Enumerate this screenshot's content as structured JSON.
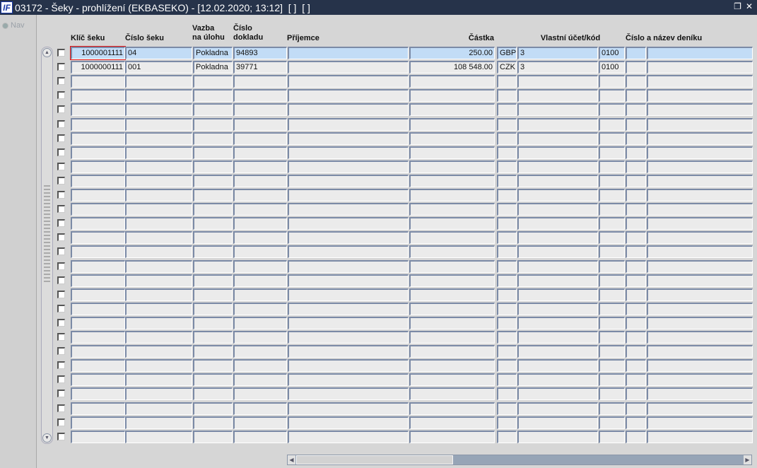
{
  "window": {
    "title": "03172 - Šeky - prohlížení (EKBASEKO) - [12.02.2020; 13:12]  [ ]  [ ]",
    "logo": "IF",
    "restore_icon": "restore-icon",
    "close_icon": "close-icon"
  },
  "left_panel": {
    "nav_label": "Nav"
  },
  "columns": {
    "klic": "Klíč šeku",
    "cislo": "Číslo šeku",
    "vazba": "Vazba\nna úlohu",
    "doklad": "Číslo\ndokladu",
    "prijemce": "Příjemce",
    "castka": "Částka",
    "ucet": "Vlastní účet/kód",
    "denik": "Číslo a název deníku"
  },
  "rows": [
    {
      "klic": "1000001111",
      "cislo": "04",
      "vazba": "Pokladna",
      "doklad": "94893",
      "prijemce": "",
      "castka": "250.00",
      "mena": "GBP",
      "ucet": "3",
      "kod": "0100",
      "denik_cislo": "",
      "denik_nazev": "",
      "selected": true
    },
    {
      "klic": "1000000111",
      "cislo": "001",
      "vazba": "Pokladna",
      "doklad": "39771",
      "prijemce": "",
      "castka": "108 548.00",
      "mena": "CZK",
      "ucet": "3",
      "kod": "0100",
      "denik_cislo": "",
      "denik_nazev": "",
      "selected": false
    }
  ],
  "empty_row_count": 26
}
